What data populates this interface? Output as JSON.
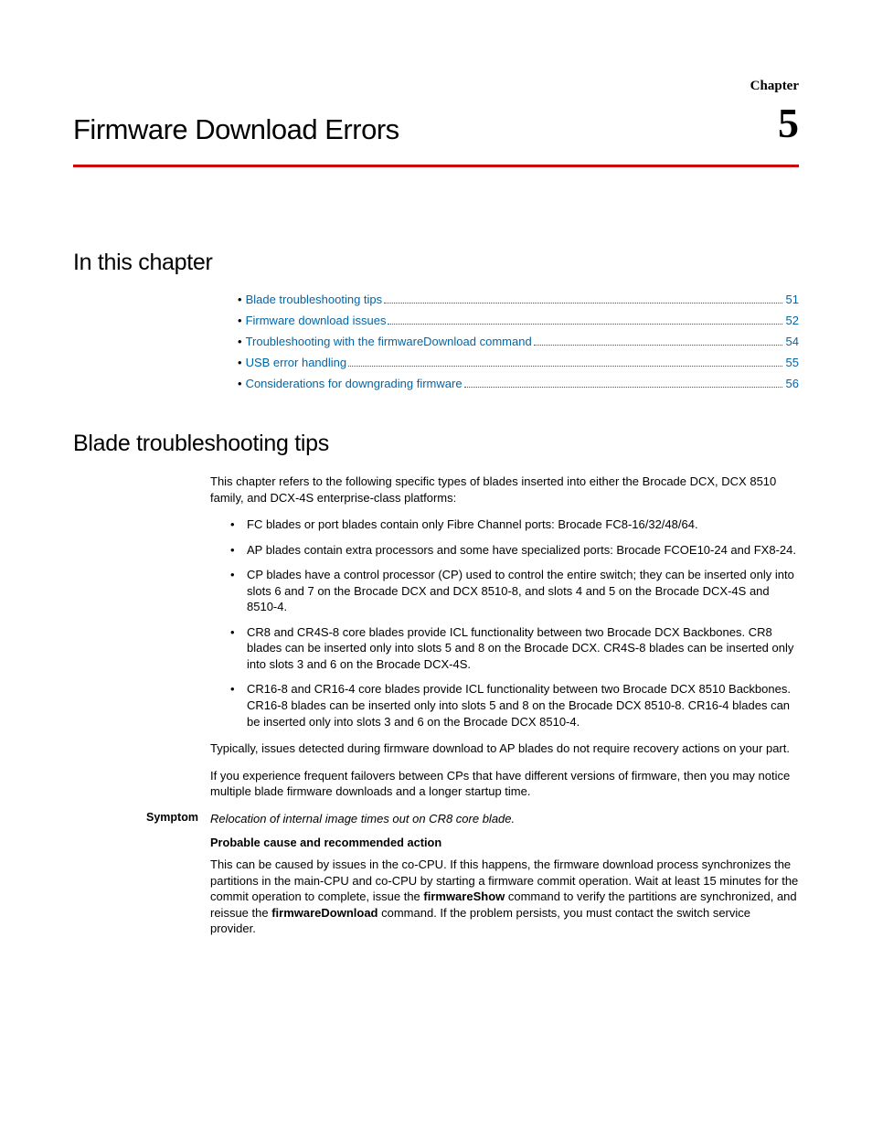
{
  "chapter": {
    "label": "Chapter",
    "number": "5",
    "title": "Firmware Download Errors"
  },
  "sections": {
    "in_this_chapter": {
      "heading": "In this chapter",
      "toc": [
        {
          "label": "Blade troubleshooting tips",
          "page": "51"
        },
        {
          "label": "Firmware download issues",
          "page": "52"
        },
        {
          "label": "Troubleshooting with the firmwareDownload command",
          "page": "54"
        },
        {
          "label": "USB error handling",
          "page": "55"
        },
        {
          "label": "Considerations for downgrading firmware",
          "page": "56"
        }
      ]
    },
    "blade_tips": {
      "heading": "Blade troubleshooting tips",
      "intro": "This chapter refers to the following specific types of blades inserted into either the Brocade DCX, DCX 8510 family, and DCX-4S enterprise-class platforms:",
      "bullets": [
        "FC blades or port blades contain only Fibre Channel ports: Brocade FC8-16/32/48/64.",
        "AP blades contain extra processors and some have specialized ports: Brocade FCOE10-24 and FX8-24.",
        "CP blades have a control processor (CP) used to control the entire switch; they can be inserted only into slots 6 and 7 on the Brocade DCX and DCX 8510-8, and slots 4 and 5 on the Brocade DCX-4S and 8510-4.",
        "CR8 and CR4S-8 core blades provide ICL functionality between two Brocade DCX Backbones. CR8 blades can be inserted only into slots 5 and 8 on the Brocade DCX. CR4S-8 blades can be inserted only into slots 3 and 6 on the Brocade DCX-4S.",
        "CR16-8 and CR16-4 core blades provide ICL functionality between two Brocade DCX 8510 Backbones. CR16-8 blades can be inserted only into slots 5 and 8 on the Brocade DCX 8510-8. CR16-4 blades can be inserted only into slots 3 and 6 on the Brocade DCX 8510-4."
      ],
      "para_after_1": "Typically, issues detected during firmware download to AP blades do not require recovery actions on your part.",
      "para_after_2": "If you experience frequent failovers between CPs that have different versions of firmware, then you may notice multiple blade firmware downloads and a longer startup time.",
      "symptom": {
        "label": "Symptom",
        "text": "Relocation of internal image times out on CR8 core blade."
      },
      "cause_heading": "Probable cause and recommended action",
      "cause_para_1a": "This can be caused by issues in the co-CPU. If this happens, the firmware download process synchronizes the partitions in the main-CPU and co-CPU by starting a firmware commit operation. Wait at least 15 minutes for the commit operation to complete, issue the ",
      "cause_para_1b": "firmwareShow",
      "cause_para_1c": " command to verify the partitions are synchronized, and reissue the ",
      "cause_para_1d": "firmwareDownload",
      "cause_para_1e": " command. If the problem persists, you must contact the switch service provider."
    }
  }
}
